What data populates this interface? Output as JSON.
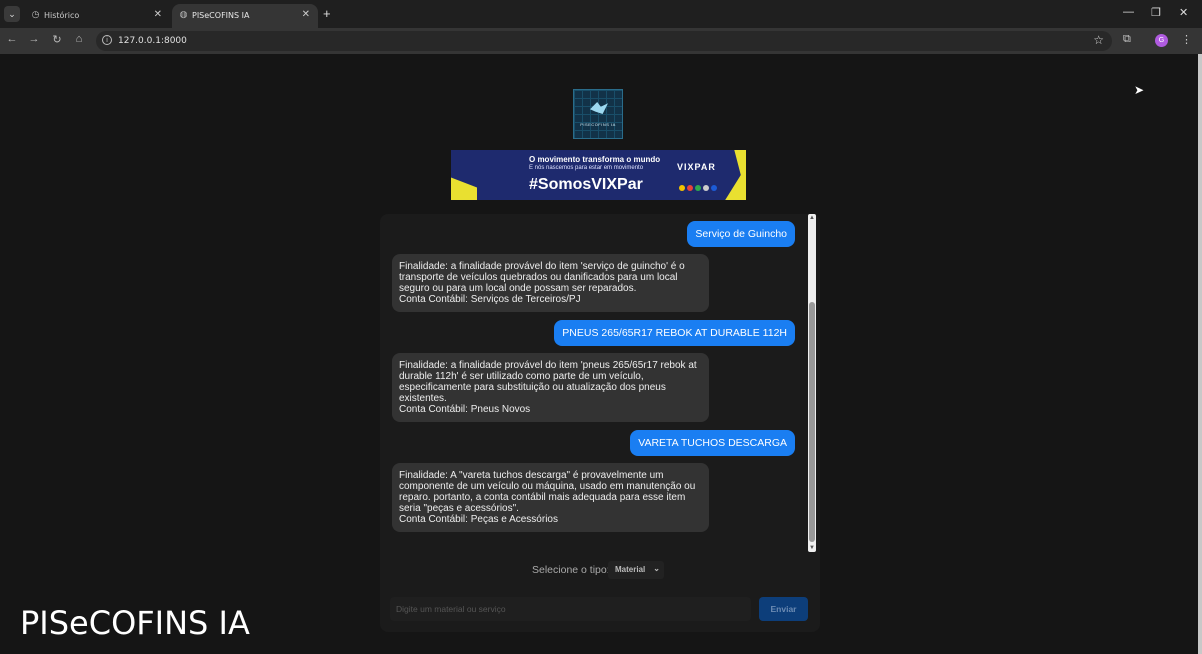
{
  "browser": {
    "tabs": [
      {
        "label": "Histórico",
        "active": false
      },
      {
        "label": "PISeCOFINS IA",
        "active": true
      }
    ],
    "url": "127.0.0.1:8000",
    "profile_initial": "G",
    "profile_color": "#b05be0"
  },
  "banner": {
    "line1": "O movimento transforma o mundo",
    "line2": "E nós nascemos para estar em movimento",
    "hashtag": "#SomosVIXPar",
    "brand": "VIXPAR"
  },
  "logo": {
    "text": "PISECOFINS IA"
  },
  "chat": {
    "messages": [
      {
        "role": "user",
        "text": "Serviço de Guincho"
      },
      {
        "role": "bot",
        "finalidade": "Finalidade: a finalidade provável do item 'serviço de guincho' é o transporte de veículos quebrados ou danificados para um local seguro ou para um local onde possam ser reparados.",
        "conta": "Conta Contábil: Serviços de Terceiros/PJ"
      },
      {
        "role": "user",
        "text": "PNEUS 265/65R17 REBOK AT DURABLE 112H"
      },
      {
        "role": "bot",
        "finalidade": "Finalidade: a finalidade provável do item 'pneus 265/65r17 rebok at durable 112h' é ser utilizado como parte de um veículo, especificamente para substituição ou atualização dos pneus existentes.",
        "conta": "Conta Contábil: Pneus Novos"
      },
      {
        "role": "user",
        "text": "VARETA TUCHOS DESCARGA"
      },
      {
        "role": "bot",
        "finalidade": "Finalidade: A \"vareta tuchos descarga\" é provavelmente um componente de um veículo ou máquina, usado em manutenção ou reparo. portanto, a conta contábil mais adequada para esse item seria \"peças e acessórios\".",
        "conta": "Conta Contábil: Peças e Acessórios"
      }
    ],
    "select_label": "Selecione o tipo:",
    "select_value": "Material",
    "input_placeholder": "Digite um material ou serviço",
    "send_label": "Enviar"
  },
  "watermark": "PISeCOFINS IA",
  "colors": {
    "user_bubble": "#1a7ef2",
    "bot_bubble": "#333333",
    "send_button": "#0d3e7a"
  }
}
